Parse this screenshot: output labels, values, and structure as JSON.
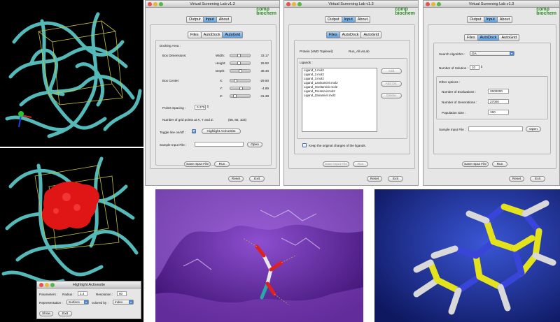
{
  "app": {
    "title": "Virtual Screening Lab v1.3",
    "logo_line1": "comp",
    "logo_line2": "biochem",
    "tabs_top": [
      "Output",
      "Input",
      "About"
    ],
    "tabs_sub": [
      "Files",
      "AutoDock",
      "AutoGrid"
    ],
    "reset_label": "Reset",
    "exit_label": "Exit",
    "save_input_label": "Save Input File",
    "run_label": "Run",
    "colors": {
      "tab_selected": "#5f9ed9",
      "logo": "#2d8a22",
      "ribbon": "#59c3c3",
      "surface_red": "#e01515",
      "purple": "#6a2aa8"
    }
  },
  "autogrid": {
    "section_title": "Docking Area :",
    "box_dimensions_label": "Box Dimensions:",
    "width_label": "Width:",
    "width_value": "33.17",
    "height_label": "Height:",
    "height_value": "29.92",
    "depth_label": "Depth:",
    "depth_value": "38.46",
    "box_center_label": "Box Center:",
    "x_label": "X:",
    "x_value": "-29.90",
    "y_label": "Y:",
    "y_value": "-4.89",
    "z_label": "Z:",
    "z_value": "-31.38",
    "points_spacing_label": "Points Spacing :",
    "points_spacing_value": "0.375",
    "num_grid_points_text": "Number of grid points at X, Y and Z:",
    "num_grid_points_value": "(88, 80, 103)",
    "toggle_label": "Toggle line on/off :",
    "highlight_label": "Highlight ActiveSite",
    "sample_input_label": "Sample Input File :",
    "open_label": "Open"
  },
  "files": {
    "protein_label": "Protein (VMD Toplevel):",
    "protein_value": "Run_All.vsLab",
    "ligands_label": "Ligands :",
    "ligands": [
      "Ligand_1.mol2",
      "Ligand_2.mol2",
      "Ligand_3.mol2",
      "Ligand_Laninamivir.mol2",
      "Ligand_Oseltamivir.mol2",
      "Ligand_Peramivir.mol2",
      "Ligand_Zanamivir.mol2"
    ],
    "add_label": "Add",
    "add_dir_label": "Add Dir.",
    "delete_label": "Delete",
    "keep_charges_label": "Keep the original charges of the ligands."
  },
  "autodock": {
    "search_algorithm_label": "Search Algorithm :",
    "search_algorithm_value": "GA",
    "num_solution_label": "Number of Solution :",
    "num_solution_value": "10",
    "other_options_label": "Other options :",
    "num_evaluations_label": "Number of Evaluations :",
    "num_evaluations_value": "2500000",
    "num_generations_label": "Number of Generations :",
    "num_generations_value": "27000",
    "population_label": "Population Size :",
    "population_value": "150",
    "sample_input_label": "Sample Input File :",
    "open_label": "Open"
  },
  "highlight_dialog": {
    "title": "Highlight Activesite",
    "parameters_label": "Parameters :",
    "radius_label": "Radius :",
    "radius_value": "1.4",
    "resolution_label": "Resolution :",
    "resolution_value": "60",
    "representation_label": "Representation :",
    "representation_value": "Surface",
    "colored_by_label": "colored by :",
    "colored_by_value": "Index",
    "show_label": "Show",
    "exit_label": "Exit"
  },
  "icons": [
    "close-dot-icon",
    "minimize-dot-icon",
    "zoom-dot-icon",
    "axes-icon",
    "checkmark-icon",
    "dropdown-arrow-icon",
    "stepper-icon"
  ]
}
